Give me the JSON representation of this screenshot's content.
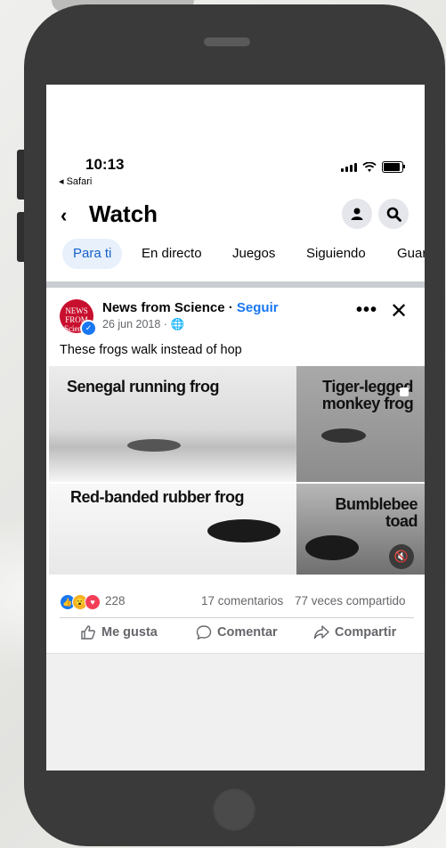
{
  "status": {
    "time": "10:13",
    "back_app": "◂ Safari"
  },
  "header": {
    "title": "Watch"
  },
  "tabs": [
    {
      "label": "Para ti"
    },
    {
      "label": "En directo"
    },
    {
      "label": "Juegos"
    },
    {
      "label": "Siguiendo"
    },
    {
      "label": "Guar"
    }
  ],
  "post": {
    "page_name": "News from Science",
    "separator": " · ",
    "follow": "Seguir",
    "date": "26 jun 2018 · ",
    "caption": "These frogs walk instead of hop",
    "avatar_text": "NEWS FROM Science",
    "video_panels": [
      {
        "label": "Senegal running frog"
      },
      {
        "label": "Tiger-legged monkey frog"
      },
      {
        "label": "Red-banded rubber frog"
      },
      {
        "label": "Bumblebee toad"
      }
    ],
    "reactions_count": "228",
    "comments": "17 comentarios",
    "shares": "77 veces compartido",
    "actions": {
      "like": "Me gusta",
      "comment": "Comentar",
      "share": "Compartir"
    }
  },
  "colors": {
    "accent": "#1877f2",
    "active_tab_bg": "#e7f0fb",
    "avatar_bg": "#c8102e"
  }
}
